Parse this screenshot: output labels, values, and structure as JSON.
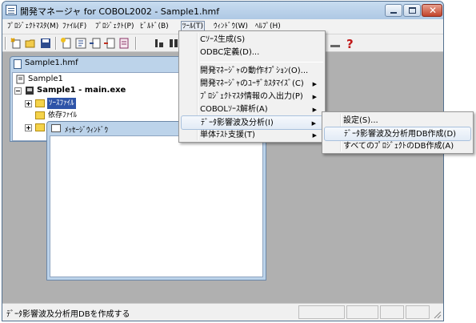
{
  "window": {
    "title": "開発マネージャ for COBOL2002 - Sample1.hmf"
  },
  "menubar": {
    "items": [
      "ﾌﾟﾛｼﾞｪｸﾄﾏｽﾀ(M)",
      "ﾌｧｲﾙ(F)",
      "ﾌﾟﾛｼﾞｪｸﾄ(P)",
      "ﾋﾞﾙﾄﾞ(B)",
      "ﾂｰﾙ(T)",
      "ｳｨﾝﾄﾞｳ(W)",
      "ﾍﾙﾌﾟ(H)"
    ],
    "active_index": 4
  },
  "tree_window": {
    "title": "Sample1.hmf",
    "nodes": [
      "Sample1",
      "Sample1 - main.exe",
      "ｿｰｽﾌｧｲﾙ",
      "依存ﾌｧｲﾙ"
    ]
  },
  "message_window": {
    "title": "ﾒｯｾｰｼﾞｳｨﾝﾄﾞｳ"
  },
  "tools_menu": {
    "items": [
      {
        "label": "Cｿｰｽ生成(S)"
      },
      {
        "label": "ODBC定義(D)..."
      },
      {
        "label": "開発ﾏﾈｰｼﾞｬの動作ｵﾌﾟｼｮﾝ(O)..."
      },
      {
        "label": "開発ﾏﾈｰｼﾞｬのﾕｰｻﾞｶｽﾀﾏｲｽﾞ(C)",
        "arrow": "▶"
      },
      {
        "label": "ﾌﾟﾛｼﾞｪｸﾄﾏｽﾀ情報の入出力(P)",
        "arrow": "▶"
      },
      {
        "label": "COBOLｿｰｽ解析(A)",
        "arrow": "▶"
      },
      {
        "label": "ﾃﾞｰﾀ影響波及分析(I)",
        "arrow": "▶"
      },
      {
        "label": "単体ﾃｽﾄ支援(T)",
        "arrow": "▶"
      }
    ]
  },
  "submenu": {
    "items": [
      {
        "label": "設定(S)..."
      },
      {
        "label": "ﾃﾞｰﾀ影響波及分析用DB作成(D)"
      },
      {
        "label": "すべてのﾌﾟﾛｼﾞｪｸﾄのDB作成(A)"
      }
    ]
  },
  "statusbar": {
    "text": "ﾃﾞｰﾀ影響波及分析用DBを作成する"
  },
  "icons": {
    "help": "?",
    "close_glyph": "✕"
  }
}
